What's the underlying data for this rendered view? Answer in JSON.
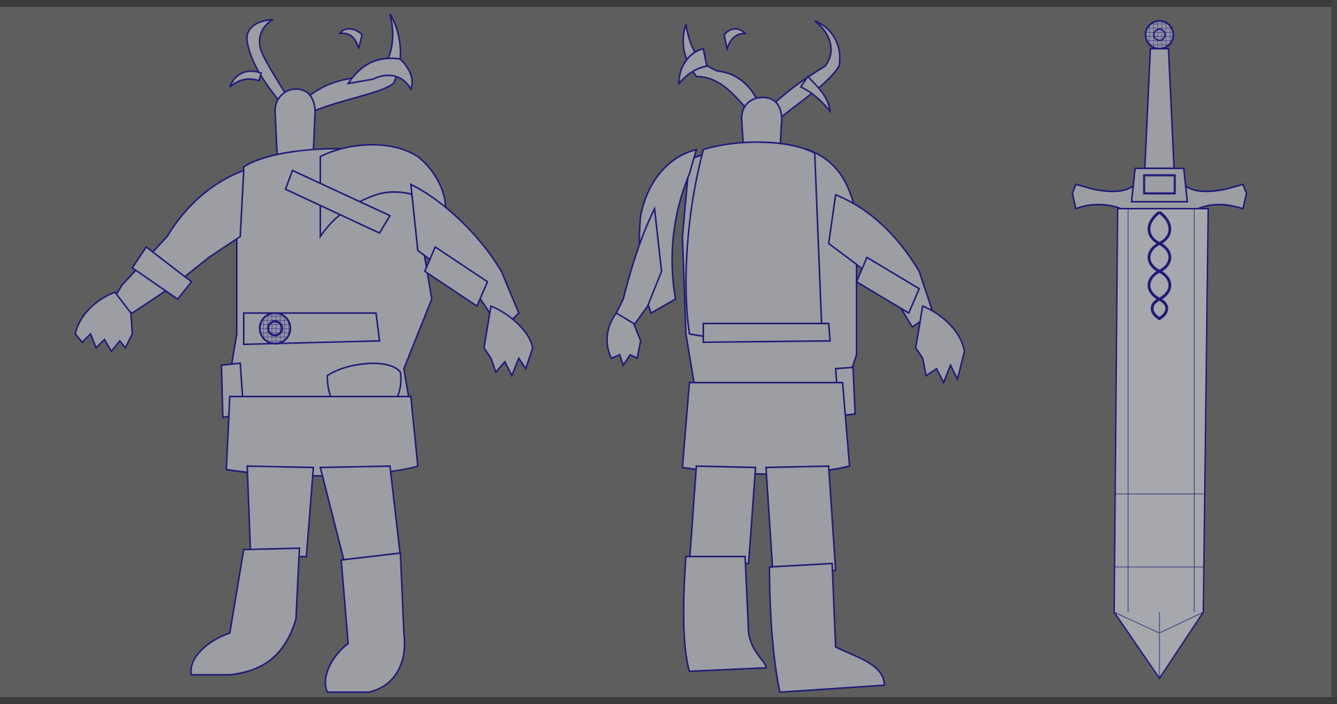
{
  "viewport": {
    "background": "#5e5e5e",
    "wire_color": "#1f1a78",
    "mesh_color": "#9c9ea4"
  },
  "objects": [
    {
      "id": "character-front",
      "label": "",
      "icon": "horned-warrior-mesh"
    },
    {
      "id": "character-back",
      "label": "",
      "icon": "horned-warrior-mesh"
    },
    {
      "id": "sword",
      "label": "",
      "icon": "sword-mesh"
    }
  ]
}
